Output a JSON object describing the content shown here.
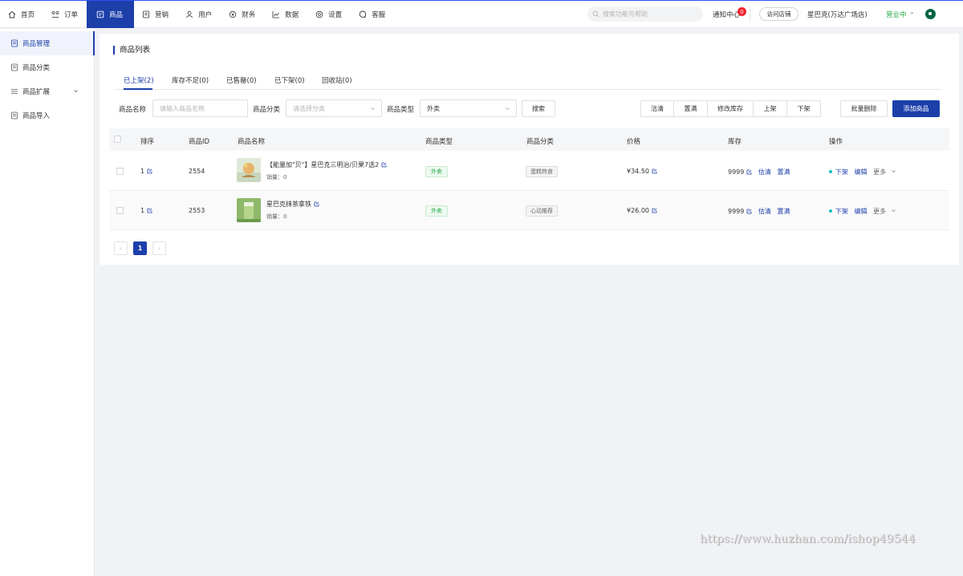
{
  "topnav": {
    "items": [
      {
        "label": "首页",
        "icon": "home-icon"
      },
      {
        "label": "订单",
        "icon": "order-icon"
      },
      {
        "label": "商品",
        "icon": "goods-icon"
      },
      {
        "label": "营销",
        "icon": "marketing-icon"
      },
      {
        "label": "用户",
        "icon": "user-icon"
      },
      {
        "label": "财务",
        "icon": "finance-icon"
      },
      {
        "label": "数据",
        "icon": "chart-icon"
      },
      {
        "label": "设置",
        "icon": "gear-icon"
      },
      {
        "label": "客服",
        "icon": "chat-icon"
      }
    ],
    "active": "商品",
    "search_placeholder": "搜索功能与帮助",
    "notify_label": "通知中心",
    "notify_count": "0",
    "visit_store": "访问店铺",
    "store_name": "星巴克(万达广场店)",
    "status": "营业中",
    "accent": "#1c3faa",
    "status_color": "#27a844"
  },
  "sidebar": {
    "items": [
      {
        "label": "商品管理",
        "icon": "goods-manage-icon"
      },
      {
        "label": "商品分类",
        "icon": "category-icon"
      },
      {
        "label": "商品扩展",
        "icon": "list-icon"
      },
      {
        "label": "商品导入",
        "icon": "import-icon"
      }
    ]
  },
  "main": {
    "title": "商品列表",
    "tabs": [
      "已上架(2)",
      "库存不足(0)",
      "已售罄(0)",
      "已下架(0)",
      "回收站(0)"
    ],
    "filters": {
      "name_label": "商品名称",
      "name_placeholder": "请输入商品名称",
      "category_label": "商品分类",
      "category_placeholder": "请选择分类",
      "type_label": "商品类型",
      "type_value": "外卖",
      "search_btn": "搜索"
    },
    "actions": [
      "沽清",
      "置满",
      "修改库存",
      "上架",
      "下架"
    ],
    "batch_delete": "批量删除",
    "add_goods": "添加商品",
    "columns": [
      "排序",
      "商品ID",
      "商品名称",
      "商品类型",
      "商品分类",
      "价格",
      "库存",
      "操作"
    ],
    "rows": [
      {
        "sort": "1",
        "id": "2554",
        "name": "【能量加\"贝\"】星巴克三明治/贝果7选2",
        "sales": "销量：0",
        "type": "外卖",
        "category": "蛋糕热食",
        "price": "¥34.50",
        "stock": "9999",
        "stock_a": "估清",
        "stock_b": "置满",
        "op_1": "下架",
        "op_2": "编辑",
        "op_3": "更多"
      },
      {
        "sort": "1",
        "id": "2553",
        "name": "星巴克抹茶拿铁",
        "sales": "销量：0",
        "type": "外卖",
        "category": "心动推荐",
        "price": "¥26.00",
        "stock": "9999",
        "stock_a": "估清",
        "stock_b": "置满",
        "op_1": "下架",
        "op_2": "编辑",
        "op_3": "更多"
      }
    ],
    "pagination": {
      "prev": "‹",
      "current": "1",
      "next": "›"
    }
  },
  "watermark": "https://www.huzhan.com/ishop49544"
}
